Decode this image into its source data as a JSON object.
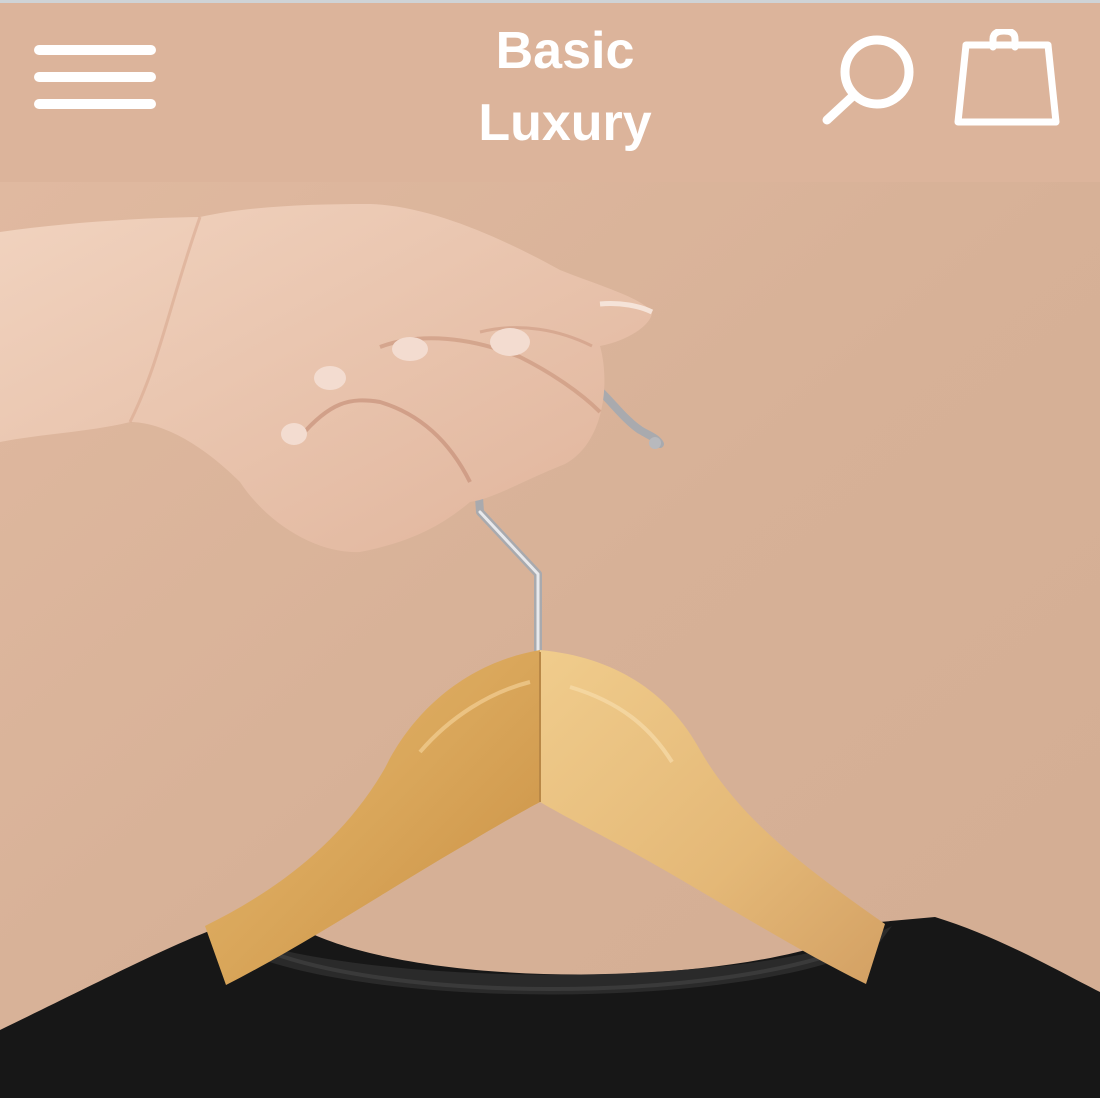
{
  "header": {
    "brand_line1": "Basic",
    "brand_line2": "Luxury",
    "menu_icon": "hamburger-menu-icon",
    "search_icon": "search-icon",
    "cart_icon": "shopping-bag-icon"
  },
  "hero": {
    "image": "hand-holding-wooden-hanger-with-black-tshirt"
  },
  "colors": {
    "header_bg": "#dcb49b",
    "hero_bg": "#d9b39a",
    "icon": "#ffffff"
  }
}
